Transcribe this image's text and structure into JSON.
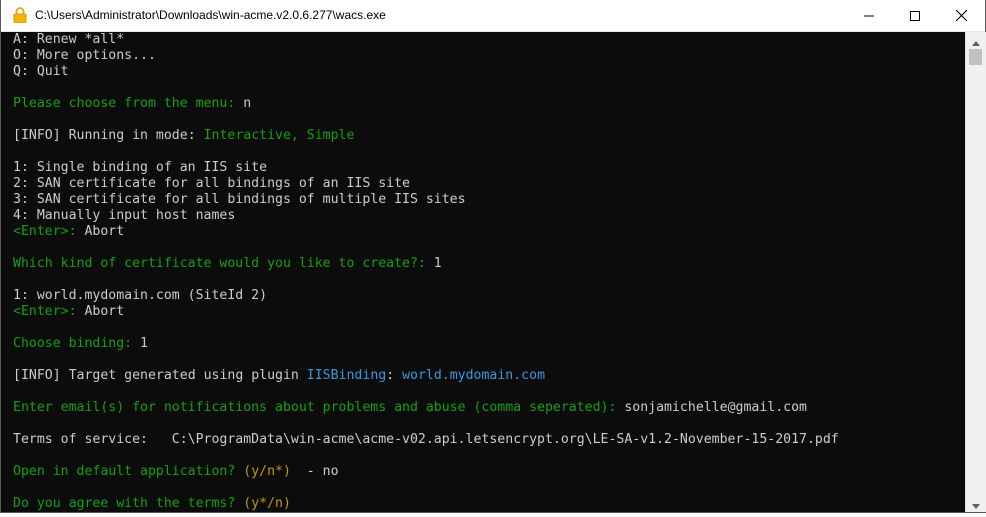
{
  "window": {
    "title": "C:\\Users\\Administrator\\Downloads\\win-acme.v2.0.6.277\\wacs.exe",
    "app_icon": "lock-icon",
    "controls": [
      "minimize-icon",
      "maximize-icon",
      "close-icon"
    ]
  },
  "console": {
    "lines": [
      [
        {
          "t": "A: Renew *all*",
          "c": "w"
        }
      ],
      [
        {
          "t": "O: More options...",
          "c": "w"
        }
      ],
      [
        {
          "t": "Q: Quit",
          "c": "w"
        }
      ],
      [],
      [
        {
          "t": "Please choose from the menu: ",
          "c": "g"
        },
        {
          "t": "n",
          "c": "w"
        }
      ],
      [],
      [
        {
          "t": "[",
          "c": "w"
        },
        {
          "t": "INFO",
          "c": "w"
        },
        {
          "t": "] Running in mode: ",
          "c": "w"
        },
        {
          "t": "Interactive, Simple",
          "c": "g"
        }
      ],
      [],
      [
        {
          "t": "1: Single binding of an IIS site",
          "c": "w"
        }
      ],
      [
        {
          "t": "2: SAN certificate for all bindings of an IIS site",
          "c": "w"
        }
      ],
      [
        {
          "t": "3: SAN certificate for all bindings of multiple IIS sites",
          "c": "w"
        }
      ],
      [
        {
          "t": "4: Manually input host names",
          "c": "w"
        }
      ],
      [
        {
          "t": "<Enter>: ",
          "c": "g"
        },
        {
          "t": "Abort",
          "c": "w"
        }
      ],
      [],
      [
        {
          "t": "Which kind of certificate would you like to create?: ",
          "c": "g"
        },
        {
          "t": "1",
          "c": "w"
        }
      ],
      [],
      [
        {
          "t": "1: world.mydomain.com (SiteId 2)",
          "c": "w"
        }
      ],
      [
        {
          "t": "<Enter>: ",
          "c": "g"
        },
        {
          "t": "Abort",
          "c": "w"
        }
      ],
      [],
      [
        {
          "t": "Choose binding: ",
          "c": "g"
        },
        {
          "t": "1",
          "c": "w"
        }
      ],
      [],
      [
        {
          "t": "[",
          "c": "w"
        },
        {
          "t": "INFO",
          "c": "w"
        },
        {
          "t": "] Target generated using plugin ",
          "c": "w"
        },
        {
          "t": "IISBinding",
          "c": "t"
        },
        {
          "t": ": ",
          "c": "w"
        },
        {
          "t": "world.mydomain.com",
          "c": "t"
        }
      ],
      [],
      [
        {
          "t": "Enter email(s) for notifications about problems and abuse (comma seperated): ",
          "c": "g"
        },
        {
          "t": "sonjamichelle@gmail.com",
          "c": "w"
        }
      ],
      [],
      [
        {
          "t": "Terms of service:   C:\\ProgramData\\win-acme\\acme-v02.api.letsencrypt.org\\LE-SA-v1.2-November-15-2017.pdf",
          "c": "w"
        }
      ],
      [],
      [
        {
          "t": "Open in default application? ",
          "c": "g"
        },
        {
          "t": "(y/n*)",
          "c": "y"
        },
        {
          "t": "  - no",
          "c": "w"
        }
      ],
      [],
      [
        {
          "t": "Do you agree with the terms? ",
          "c": "g"
        },
        {
          "t": "(y*/n)",
          "c": "y"
        }
      ]
    ]
  },
  "colors": {
    "console_bg": "#0c0c0c",
    "white": "#cccccc",
    "green": "#13a10e",
    "teal": "#3a96dd",
    "yellow": "#c19c00"
  },
  "scrollbar": {
    "up": "arrow-up-icon",
    "down": "arrow-down-icon"
  }
}
